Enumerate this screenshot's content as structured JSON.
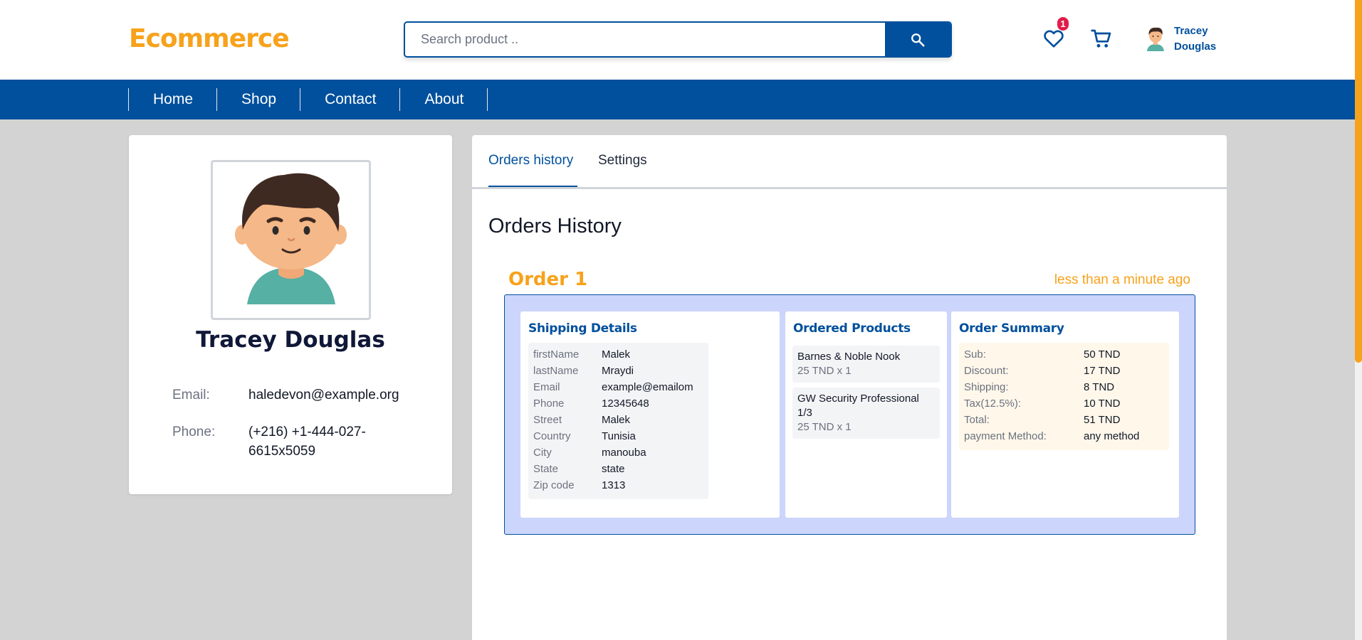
{
  "header": {
    "logo": "Ecommerce",
    "search_placeholder": "Search product ..",
    "wishlist_count": "1",
    "user_first": "Tracey",
    "user_last": "Douglas"
  },
  "nav": [
    "Home",
    "Shop",
    "Contact",
    "About"
  ],
  "profile": {
    "name": "Tracey Douglas",
    "email_label": "Email:",
    "email": "haledevon@example.org",
    "phone_label": "Phone:",
    "phone": "(+216) +1-444-027-6615x5059"
  },
  "tabs": [
    "Orders history",
    "Settings"
  ],
  "section_title": "Orders History",
  "order": {
    "title": "Order 1",
    "time": "less than a minute ago",
    "shipping": {
      "title": "Shipping Details",
      "rows": [
        {
          "k": "firstName",
          "v": "Malek"
        },
        {
          "k": "lastName",
          "v": "Mraydi"
        },
        {
          "k": "Email",
          "v": "example@emailom"
        },
        {
          "k": "Phone",
          "v": "12345648"
        },
        {
          "k": "Street",
          "v": "Malek"
        },
        {
          "k": "Country",
          "v": "Tunisia"
        },
        {
          "k": "City",
          "v": "manouba"
        },
        {
          "k": "State",
          "v": "state"
        },
        {
          "k": "Zip code",
          "v": "1313"
        }
      ]
    },
    "products": {
      "title": "Ordered Products",
      "items": [
        {
          "name": "Barnes & Noble Nook",
          "price": "25 TND x 1"
        },
        {
          "name": "GW Security Professional 1/3",
          "price": "25 TND x 1"
        }
      ]
    },
    "summary": {
      "title": "Order Summary",
      "rows": [
        {
          "k": "Sub:",
          "v": "50 TND"
        },
        {
          "k": "Discount:",
          "v": "17 TND"
        },
        {
          "k": "Shipping:",
          "v": "8 TND"
        },
        {
          "k": "Tax(12.5%):",
          "v": "10 TND"
        },
        {
          "k": "Total:",
          "v": "51 TND"
        },
        {
          "k": "payment Method:",
          "v": "any method"
        }
      ]
    }
  },
  "colors": {
    "brand_blue": "#00509d",
    "accent_orange": "#f7a21b",
    "order_box_bg": "#ccd5fb",
    "summary_bg": "#fff7ea",
    "badge_red": "#e11d48"
  }
}
